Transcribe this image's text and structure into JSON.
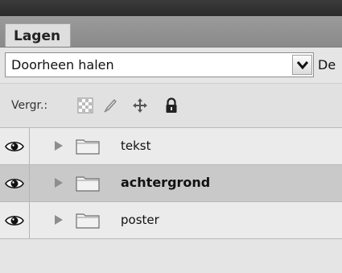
{
  "panel": {
    "tab_label": "Lagen"
  },
  "blend": {
    "mode": "Doorheen halen",
    "opacity_label": "De"
  },
  "locks": {
    "label": "Vergr.:"
  },
  "layers": [
    {
      "name": "tekst",
      "visible": true,
      "type": "group",
      "selected": false
    },
    {
      "name": "achtergrond",
      "visible": true,
      "type": "group",
      "selected": true
    },
    {
      "name": "poster",
      "visible": true,
      "type": "group",
      "selected": false
    }
  ],
  "icons": {
    "eye": "eye-icon",
    "expand": "disclosure-triangle-icon",
    "folder": "folder-icon",
    "lock_transparent": "lock-transparent-pixels-icon",
    "lock_image": "lock-image-pixels-icon",
    "lock_position": "lock-position-icon",
    "lock_all": "lock-all-icon"
  }
}
